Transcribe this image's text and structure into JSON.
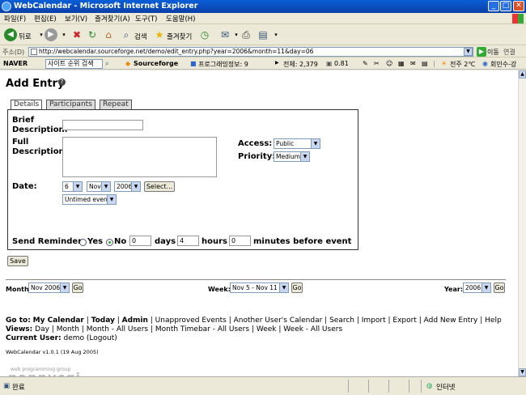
{
  "window": {
    "title": "WebCalendar - Microsoft Internet Explorer"
  },
  "menu": [
    "파일(F)",
    "편집(E)",
    "보기(V)",
    "즐겨찾기(A)",
    "도구(T)",
    "도움말(H)"
  ],
  "toolbar": {
    "back_label": "뒤로",
    "search_label": "검색",
    "favorites_label": "즐겨찾기"
  },
  "address": {
    "label": "주소(D)",
    "url": "http://webcalendar.sourceforge.net/demo/edit_entry.php?year=2006&month=11&day=06",
    "go_label": "이동",
    "links_label": "연결"
  },
  "naverbar": {
    "brand": "NAVER",
    "search_placeholder": "사이트 순위 검색",
    "sourceforge": "Sourceforge",
    "programming_info": "프로그래밍정보: 9",
    "total": "전체: 2,379",
    "ratio": "0.81",
    "weather": "전주 2℃",
    "exchange": "회민수-강"
  },
  "page": {
    "title": "Add Entry",
    "tabs": [
      "Details",
      "Participants",
      "Repeat"
    ],
    "form": {
      "brief_label": "Brief Description:",
      "brief_line1": "Brief",
      "brief_line2": "Description:",
      "full_line1": "Full",
      "full_line2": "Description:",
      "access_label": "Access:",
      "access_value": "Public",
      "priority_label": "Priority:",
      "priority_value": "Medium",
      "date_label": "Date:",
      "day_value": "6",
      "month_value": "Nov",
      "year_value": "2006",
      "select_button": "Select...",
      "time_type": "Untimed event",
      "reminder_label": "Send Reminder:",
      "reminder_yes": "Yes",
      "reminder_no": "No",
      "reminder_days_value": "0",
      "days_label": "days",
      "reminder_hours_value": "4",
      "hours_label": "hours",
      "reminder_minutes_value": "0",
      "minutes_label": "minutes before event"
    },
    "save_button": "Save",
    "nav": {
      "month_label": "Month:",
      "month_value": "Nov 2006",
      "week_label": "Week:",
      "week_value": "Nov 5 - Nov 11",
      "year_label": "Year:",
      "year_value": "2006",
      "go": "Go"
    },
    "footer": {
      "goto_label": "Go to:",
      "goto_bold": [
        "My Calendar",
        "Today",
        "Admin"
      ],
      "goto_links": [
        "Unapproved Events",
        "Another User's Calendar",
        "Search",
        "Import",
        "Export",
        "Add New Entry",
        "Help"
      ],
      "views_label": "Views:",
      "views_links": [
        "Day",
        "Month",
        "Month - All Users",
        "Month Timebar - All Users",
        "Week",
        "Week - All Users"
      ],
      "current_user_label": "Current User:",
      "current_user_value": "demo (Logout)",
      "version": "WebCalendar v1.0.1 (19 Aug 2005)"
    },
    "logo": {
      "tagline": "web programming group",
      "name": "nappycgi"
    }
  },
  "status": {
    "left": "완료",
    "zone": "인터넷"
  },
  "colors": {
    "titlebar": "#0a3fa8",
    "chrome": "#ece9d8",
    "page_bg": "#ffffff"
  }
}
